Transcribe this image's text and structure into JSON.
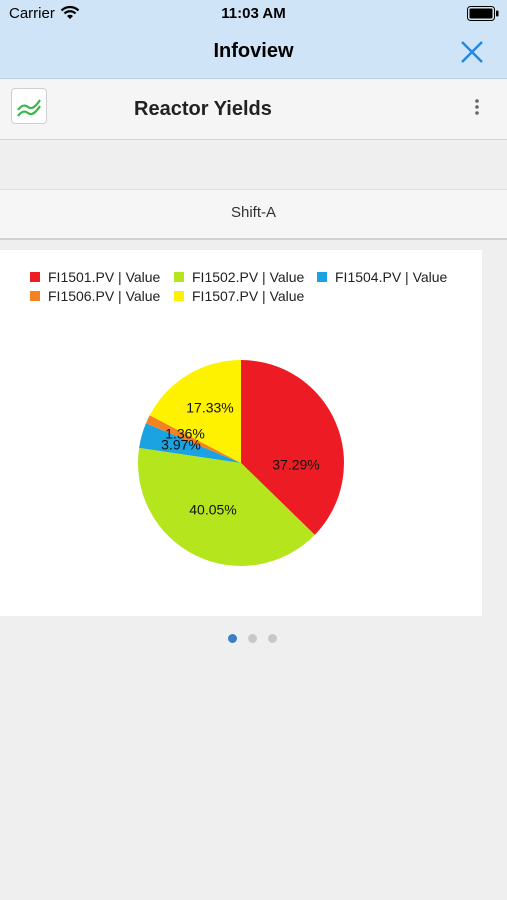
{
  "status_bar": {
    "carrier": "Carrier",
    "time": "11:03 AM"
  },
  "nav": {
    "title": "Infoview",
    "close_icon": "close-icon"
  },
  "header": {
    "title": "Reactor Yields",
    "app_icon": "line-chart-icon",
    "menu_icon": "more-vertical-icon"
  },
  "shift": {
    "label": "Shift-A"
  },
  "pager": {
    "count": 3,
    "active": 0
  },
  "chart_data": {
    "type": "pie",
    "series": [
      {
        "name": "FI1501.PV | Value",
        "value": 37.29,
        "label": "37.29%",
        "color": "#ed1c24"
      },
      {
        "name": "FI1502.PV | Value",
        "value": 40.05,
        "label": "40.05%",
        "color": "#b5e51d"
      },
      {
        "name": "FI1504.PV | Value",
        "value": 3.97,
        "label": "3.97%",
        "color": "#1aa3e0"
      },
      {
        "name": "FI1506.PV | Value",
        "value": 1.36,
        "label": "1.36%",
        "color": "#f58220"
      },
      {
        "name": "FI1507.PV | Value",
        "value": 17.33,
        "label": "17.33%",
        "color": "#fff200"
      }
    ],
    "legend_position": "top"
  }
}
